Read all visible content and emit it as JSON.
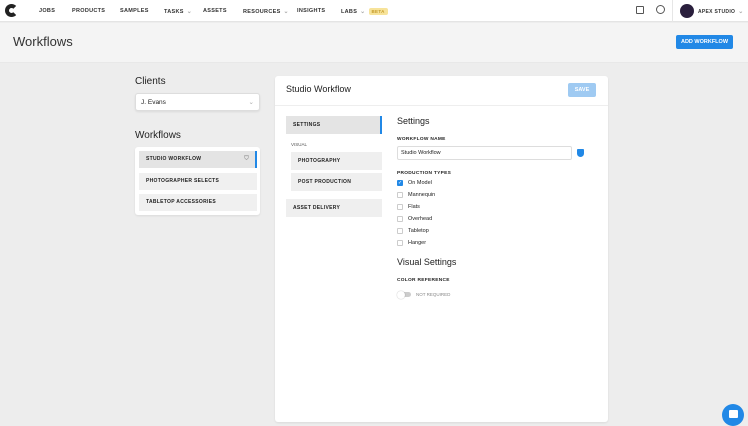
{
  "nav": {
    "items": [
      "JOBS",
      "PRODUCTS",
      "SAMPLES",
      "TASKS",
      "ASSETS",
      "RESOURCES",
      "INSIGHTS",
      "LABS"
    ],
    "beta": "BETA",
    "account": "APEX STUDIO"
  },
  "page": {
    "title": "Workflows",
    "add_button": "ADD WORKFLOW"
  },
  "clients": {
    "heading": "Clients",
    "selected": "J. Evans"
  },
  "workflows": {
    "heading": "Workflows",
    "items": [
      "STUDIO WORKFLOW",
      "PHOTOGRAPHER SELECTS",
      "TABLETOP ACCESSORIES"
    ]
  },
  "editor": {
    "title": "Studio Workflow",
    "save": "SAVE",
    "side": {
      "settings": "SETTINGS",
      "visual": "VISUAL",
      "photography": "PHOTOGRAPHY",
      "post": "POST PRODUCTION",
      "delivery": "ASSET DELIVERY"
    },
    "settings_heading": "Settings",
    "name_label": "WORKFLOW NAME",
    "name_value": "Studio Workflow",
    "types_label": "PRODUCTION TYPES",
    "types": [
      {
        "label": "On Model",
        "checked": true
      },
      {
        "label": "Mannequin",
        "checked": false
      },
      {
        "label": "Flats",
        "checked": false
      },
      {
        "label": "Overhead",
        "checked": false
      },
      {
        "label": "Tabletop",
        "checked": false
      },
      {
        "label": "Hanger",
        "checked": false
      }
    ],
    "visual_heading": "Visual Settings",
    "color_label": "COLOR REFERENCE",
    "color_toggle": "NOT REQUIRED"
  },
  "colors": {
    "accent": "#2188e6"
  }
}
